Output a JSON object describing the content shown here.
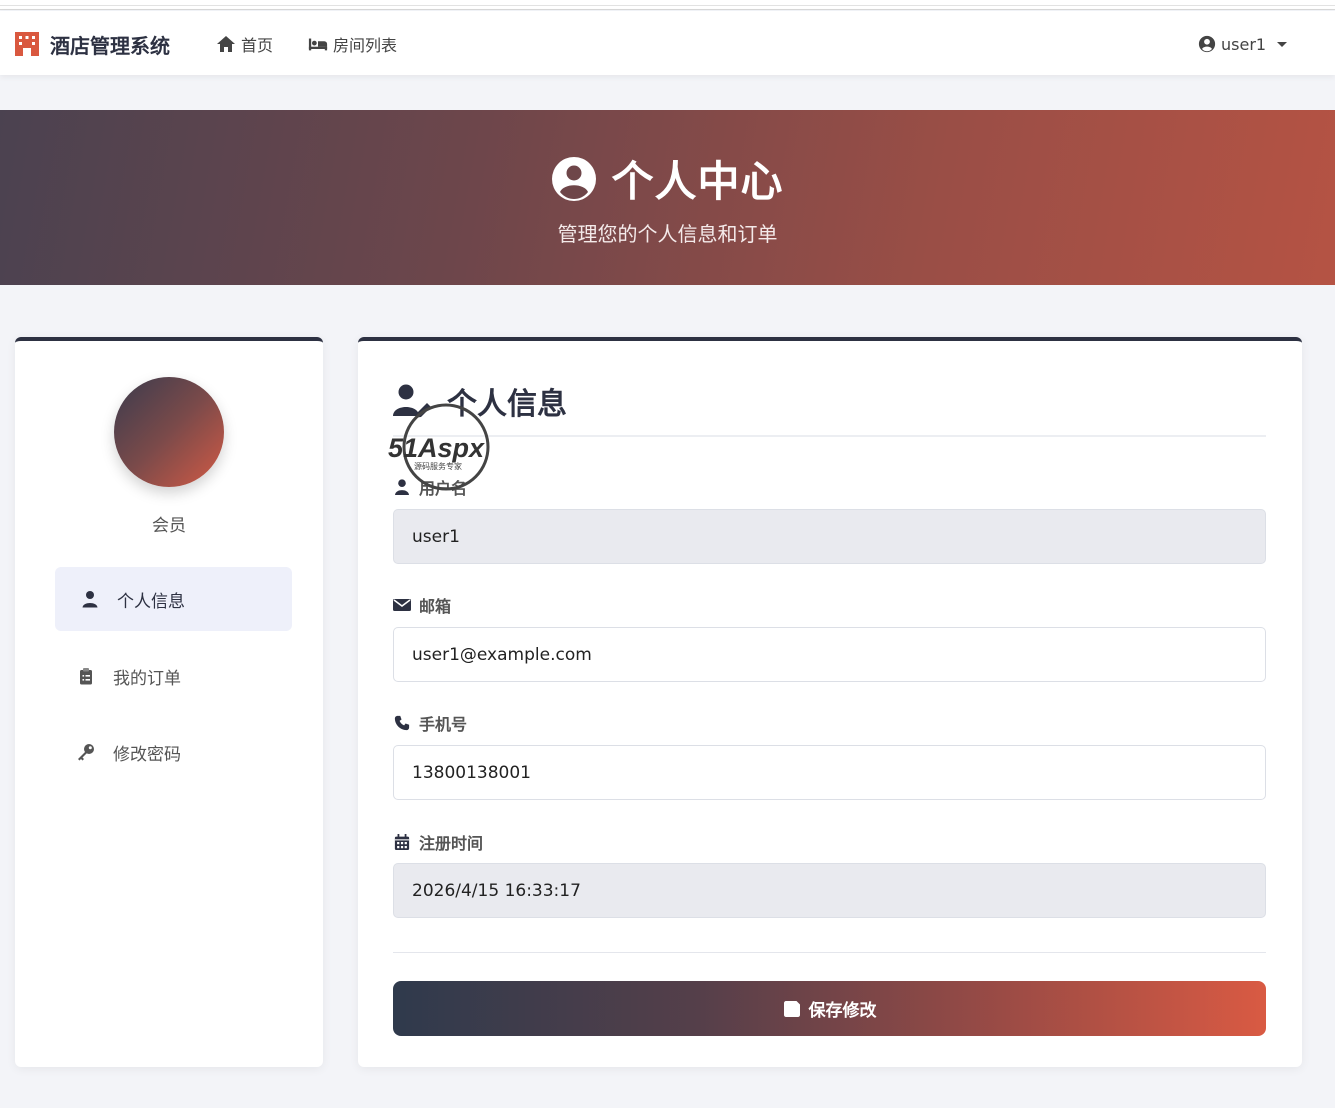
{
  "app": {
    "brand": "酒店管理系统",
    "brand_color": "#d9583f"
  },
  "navbar": {
    "home_label": "首页",
    "rooms_label": "房间列表",
    "user_label": "user1"
  },
  "hero": {
    "title": "个人中心",
    "subtitle": "管理您的个人信息和订单"
  },
  "sidebar": {
    "member_label": "会员",
    "items": [
      {
        "label": "个人信息",
        "icon": "user-icon",
        "active": true
      },
      {
        "label": "我的订单",
        "icon": "clipboard-icon",
        "active": false
      },
      {
        "label": "修改密码",
        "icon": "key-icon",
        "active": false
      }
    ]
  },
  "profile": {
    "section_title": "个人信息",
    "username_label": "用户名",
    "username_value": "user1",
    "email_label": "邮箱",
    "email_value": "user1@example.com",
    "phone_label": "手机号",
    "phone_value": "13800138001",
    "register_label": "注册时间",
    "register_value": "2026/4/15 16:33:17",
    "save_label": "保存修改"
  },
  "watermark": {
    "brand": "51Aspx",
    "tagline": "源码服务专家"
  },
  "colors": {
    "primary_dark": "#2d3142",
    "accent": "#d95a43",
    "page_bg": "#f3f4f8"
  }
}
